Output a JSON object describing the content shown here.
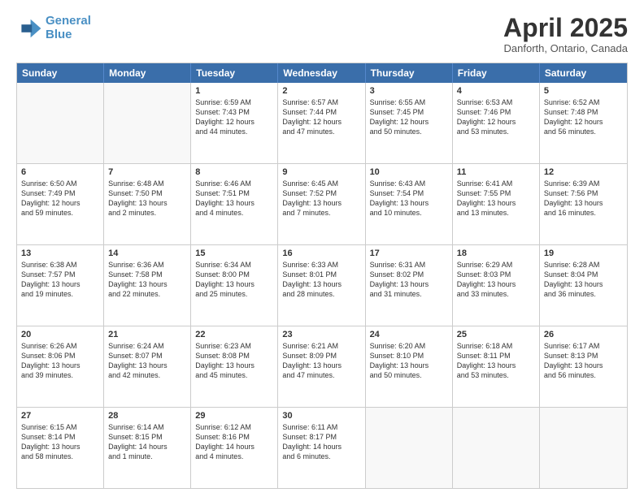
{
  "logo": {
    "line1": "General",
    "line2": "Blue"
  },
  "header": {
    "month": "April 2025",
    "location": "Danforth, Ontario, Canada"
  },
  "days": [
    "Sunday",
    "Monday",
    "Tuesday",
    "Wednesday",
    "Thursday",
    "Friday",
    "Saturday"
  ],
  "rows": [
    [
      {
        "day": "",
        "lines": []
      },
      {
        "day": "",
        "lines": []
      },
      {
        "day": "1",
        "lines": [
          "Sunrise: 6:59 AM",
          "Sunset: 7:43 PM",
          "Daylight: 12 hours",
          "and 44 minutes."
        ]
      },
      {
        "day": "2",
        "lines": [
          "Sunrise: 6:57 AM",
          "Sunset: 7:44 PM",
          "Daylight: 12 hours",
          "and 47 minutes."
        ]
      },
      {
        "day": "3",
        "lines": [
          "Sunrise: 6:55 AM",
          "Sunset: 7:45 PM",
          "Daylight: 12 hours",
          "and 50 minutes."
        ]
      },
      {
        "day": "4",
        "lines": [
          "Sunrise: 6:53 AM",
          "Sunset: 7:46 PM",
          "Daylight: 12 hours",
          "and 53 minutes."
        ]
      },
      {
        "day": "5",
        "lines": [
          "Sunrise: 6:52 AM",
          "Sunset: 7:48 PM",
          "Daylight: 12 hours",
          "and 56 minutes."
        ]
      }
    ],
    [
      {
        "day": "6",
        "lines": [
          "Sunrise: 6:50 AM",
          "Sunset: 7:49 PM",
          "Daylight: 12 hours",
          "and 59 minutes."
        ]
      },
      {
        "day": "7",
        "lines": [
          "Sunrise: 6:48 AM",
          "Sunset: 7:50 PM",
          "Daylight: 13 hours",
          "and 2 minutes."
        ]
      },
      {
        "day": "8",
        "lines": [
          "Sunrise: 6:46 AM",
          "Sunset: 7:51 PM",
          "Daylight: 13 hours",
          "and 4 minutes."
        ]
      },
      {
        "day": "9",
        "lines": [
          "Sunrise: 6:45 AM",
          "Sunset: 7:52 PM",
          "Daylight: 13 hours",
          "and 7 minutes."
        ]
      },
      {
        "day": "10",
        "lines": [
          "Sunrise: 6:43 AM",
          "Sunset: 7:54 PM",
          "Daylight: 13 hours",
          "and 10 minutes."
        ]
      },
      {
        "day": "11",
        "lines": [
          "Sunrise: 6:41 AM",
          "Sunset: 7:55 PM",
          "Daylight: 13 hours",
          "and 13 minutes."
        ]
      },
      {
        "day": "12",
        "lines": [
          "Sunrise: 6:39 AM",
          "Sunset: 7:56 PM",
          "Daylight: 13 hours",
          "and 16 minutes."
        ]
      }
    ],
    [
      {
        "day": "13",
        "lines": [
          "Sunrise: 6:38 AM",
          "Sunset: 7:57 PM",
          "Daylight: 13 hours",
          "and 19 minutes."
        ]
      },
      {
        "day": "14",
        "lines": [
          "Sunrise: 6:36 AM",
          "Sunset: 7:58 PM",
          "Daylight: 13 hours",
          "and 22 minutes."
        ]
      },
      {
        "day": "15",
        "lines": [
          "Sunrise: 6:34 AM",
          "Sunset: 8:00 PM",
          "Daylight: 13 hours",
          "and 25 minutes."
        ]
      },
      {
        "day": "16",
        "lines": [
          "Sunrise: 6:33 AM",
          "Sunset: 8:01 PM",
          "Daylight: 13 hours",
          "and 28 minutes."
        ]
      },
      {
        "day": "17",
        "lines": [
          "Sunrise: 6:31 AM",
          "Sunset: 8:02 PM",
          "Daylight: 13 hours",
          "and 31 minutes."
        ]
      },
      {
        "day": "18",
        "lines": [
          "Sunrise: 6:29 AM",
          "Sunset: 8:03 PM",
          "Daylight: 13 hours",
          "and 33 minutes."
        ]
      },
      {
        "day": "19",
        "lines": [
          "Sunrise: 6:28 AM",
          "Sunset: 8:04 PM",
          "Daylight: 13 hours",
          "and 36 minutes."
        ]
      }
    ],
    [
      {
        "day": "20",
        "lines": [
          "Sunrise: 6:26 AM",
          "Sunset: 8:06 PM",
          "Daylight: 13 hours",
          "and 39 minutes."
        ]
      },
      {
        "day": "21",
        "lines": [
          "Sunrise: 6:24 AM",
          "Sunset: 8:07 PM",
          "Daylight: 13 hours",
          "and 42 minutes."
        ]
      },
      {
        "day": "22",
        "lines": [
          "Sunrise: 6:23 AM",
          "Sunset: 8:08 PM",
          "Daylight: 13 hours",
          "and 45 minutes."
        ]
      },
      {
        "day": "23",
        "lines": [
          "Sunrise: 6:21 AM",
          "Sunset: 8:09 PM",
          "Daylight: 13 hours",
          "and 47 minutes."
        ]
      },
      {
        "day": "24",
        "lines": [
          "Sunrise: 6:20 AM",
          "Sunset: 8:10 PM",
          "Daylight: 13 hours",
          "and 50 minutes."
        ]
      },
      {
        "day": "25",
        "lines": [
          "Sunrise: 6:18 AM",
          "Sunset: 8:11 PM",
          "Daylight: 13 hours",
          "and 53 minutes."
        ]
      },
      {
        "day": "26",
        "lines": [
          "Sunrise: 6:17 AM",
          "Sunset: 8:13 PM",
          "Daylight: 13 hours",
          "and 56 minutes."
        ]
      }
    ],
    [
      {
        "day": "27",
        "lines": [
          "Sunrise: 6:15 AM",
          "Sunset: 8:14 PM",
          "Daylight: 13 hours",
          "and 58 minutes."
        ]
      },
      {
        "day": "28",
        "lines": [
          "Sunrise: 6:14 AM",
          "Sunset: 8:15 PM",
          "Daylight: 14 hours",
          "and 1 minute."
        ]
      },
      {
        "day": "29",
        "lines": [
          "Sunrise: 6:12 AM",
          "Sunset: 8:16 PM",
          "Daylight: 14 hours",
          "and 4 minutes."
        ]
      },
      {
        "day": "30",
        "lines": [
          "Sunrise: 6:11 AM",
          "Sunset: 8:17 PM",
          "Daylight: 14 hours",
          "and 6 minutes."
        ]
      },
      {
        "day": "",
        "lines": []
      },
      {
        "day": "",
        "lines": []
      },
      {
        "day": "",
        "lines": []
      }
    ]
  ]
}
